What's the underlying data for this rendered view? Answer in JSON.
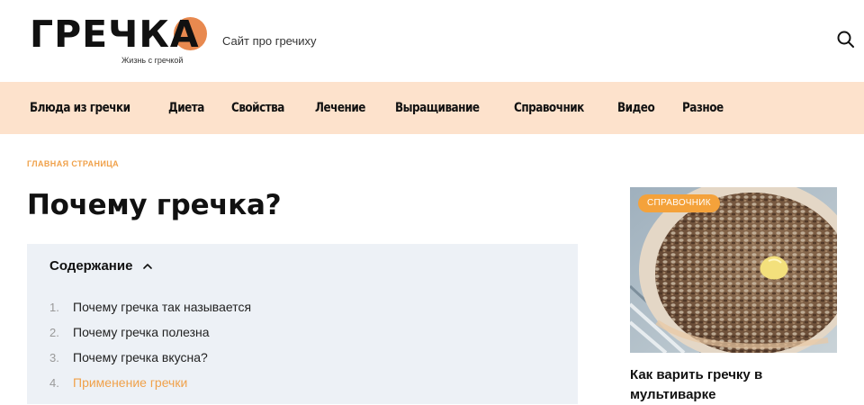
{
  "header": {
    "logo_text": "ГРЕЧКА",
    "logo_subtitle": "Жизнь с гречкой",
    "tagline": "Сайт про гречиху",
    "search_icon": "search-icon",
    "accent_color": "#e8894f"
  },
  "nav": {
    "items": [
      {
        "label": "Блюда из гречки"
      },
      {
        "label": "Диета"
      },
      {
        "label": "Свойства"
      },
      {
        "label": "Лечение"
      },
      {
        "label": "Выращивание"
      },
      {
        "label": "Справочник"
      },
      {
        "label": "Видео"
      },
      {
        "label": "Разное"
      }
    ],
    "background": "#fde2cc"
  },
  "breadcrumb": {
    "home": "Главная страница"
  },
  "article": {
    "title": "Почему гречка?"
  },
  "toc": {
    "title": "Содержание",
    "chevron_icon": "chevron-up-icon",
    "items": [
      {
        "num": "1.",
        "label": "Почему гречка так называется"
      },
      {
        "num": "2.",
        "label": "Почему гречка полезна"
      },
      {
        "num": "3.",
        "label": "Почему гречка вкусна?"
      },
      {
        "num": "4.",
        "label": "Применение гречки"
      }
    ],
    "active_color": "#f0a14a"
  },
  "sidebar_card": {
    "badge": "Справочник",
    "title": "Как варить гречку в мультиварке",
    "badge_color": "#f4a23b"
  }
}
